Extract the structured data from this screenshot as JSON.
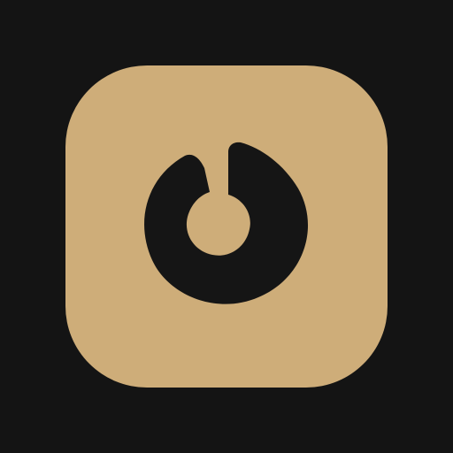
{
  "app_icon": {
    "icon": "power-icon",
    "background_color": "#141414",
    "tile_color": "#cead79",
    "glyph_color": "#151515"
  }
}
